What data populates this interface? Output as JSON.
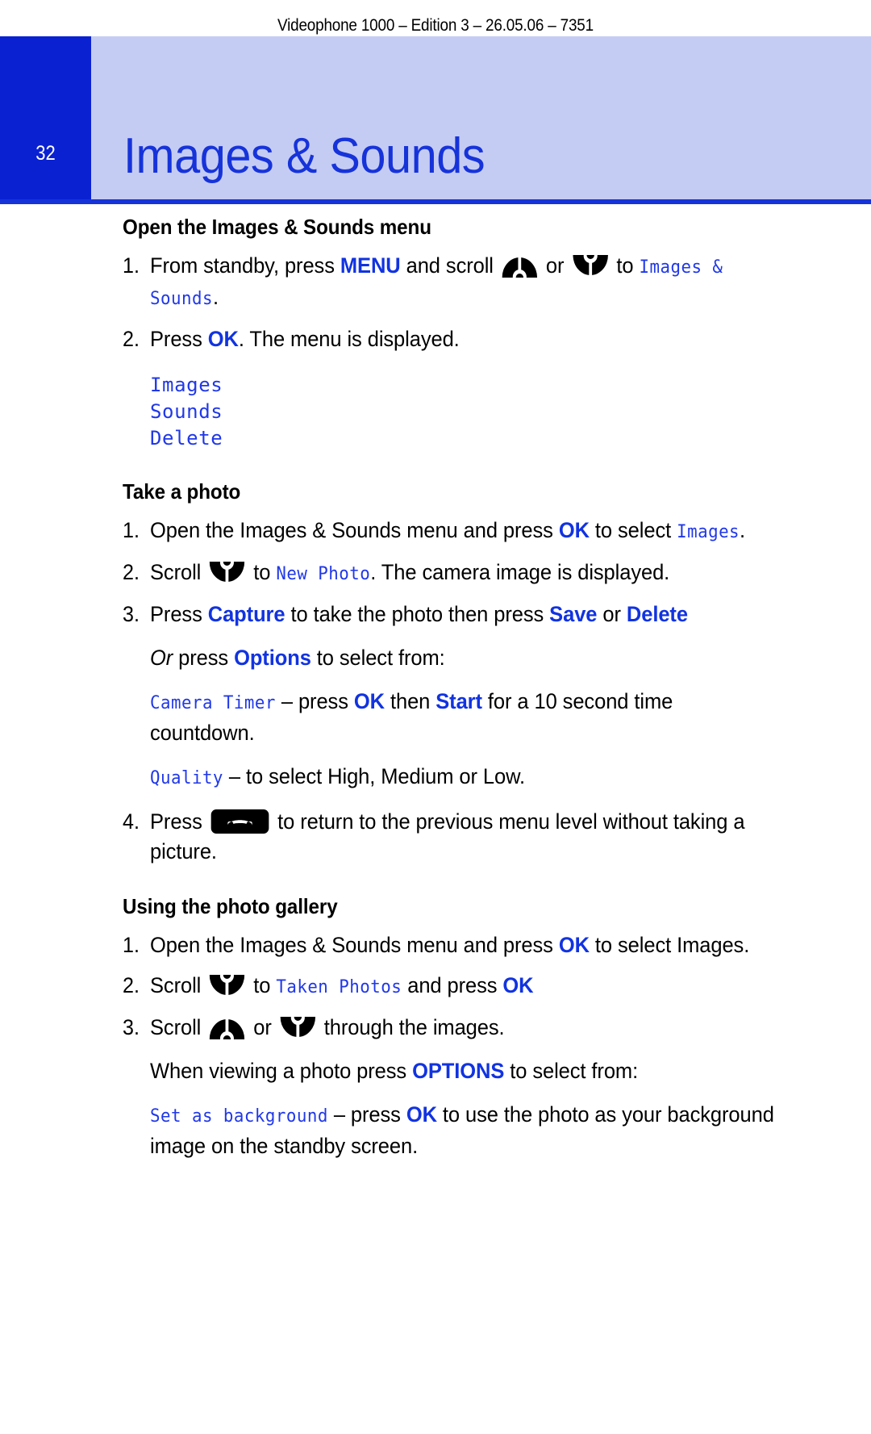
{
  "running_head": "Videophone 1000 – Edition 3 – 26.05.06 – 7351",
  "header": {
    "page_number": "32",
    "chapter_title": "Images & Sounds",
    "band_color": "#C5CCF3",
    "page_block_color": "#0A21D2",
    "title_color": "#1633DA",
    "rule_color": "#1533D8"
  },
  "colors": {
    "keyword_blue": "#1133E0",
    "lcd_blue": "#2038E8",
    "body_black": "#000000"
  },
  "icons": {
    "scroll_up": "scroll-up-icon",
    "scroll_down": "scroll-down-icon",
    "end_call": "end-call-icon"
  },
  "sections": [
    {
      "heading": "Open the Images & Sounds menu",
      "steps": [
        {
          "num": "1.",
          "parts": [
            {
              "t": "text",
              "v": "From standby, press "
            },
            {
              "t": "kw",
              "v": "MENU"
            },
            {
              "t": "text",
              "v": " and scroll "
            },
            {
              "t": "icon",
              "v": "scroll-up-icon"
            },
            {
              "t": "text",
              "v": " or "
            },
            {
              "t": "icon",
              "v": "scroll-down-icon"
            },
            {
              "t": "text",
              "v": " to "
            },
            {
              "t": "lcd",
              "v": "Images & Sounds"
            },
            {
              "t": "text",
              "v": "."
            }
          ]
        },
        {
          "num": "2.",
          "parts": [
            {
              "t": "text",
              "v": "Press "
            },
            {
              "t": "kw",
              "v": "OK"
            },
            {
              "t": "text",
              "v": ". The menu is displayed."
            }
          ]
        }
      ],
      "lcd_menu": [
        "Images",
        "Sounds",
        "Delete"
      ]
    },
    {
      "heading": "Take a photo",
      "steps": [
        {
          "num": "1.",
          "parts": [
            {
              "t": "text",
              "v": "Open the Images & Sounds menu and press "
            },
            {
              "t": "kw",
              "v": "OK"
            },
            {
              "t": "text",
              "v": " to select "
            },
            {
              "t": "lcd",
              "v": "Images"
            },
            {
              "t": "text",
              "v": "."
            }
          ]
        },
        {
          "num": "2.",
          "parts": [
            {
              "t": "text",
              "v": "Scroll "
            },
            {
              "t": "icon",
              "v": "scroll-down-icon"
            },
            {
              "t": "text",
              "v": " to "
            },
            {
              "t": "lcd",
              "v": "New Photo"
            },
            {
              "t": "text",
              "v": ". The camera image is displayed."
            }
          ]
        },
        {
          "num": "3.",
          "parts": [
            {
              "t": "text",
              "v": "Press "
            },
            {
              "t": "kw",
              "v": "Capture"
            },
            {
              "t": "text",
              "v": " to take the photo then press "
            },
            {
              "t": "kw",
              "v": "Save"
            },
            {
              "t": "text",
              "v": " or "
            },
            {
              "t": "kw",
              "v": "Delete"
            }
          ]
        }
      ],
      "paragraphs": [
        {
          "parts": [
            {
              "t": "it",
              "v": "Or"
            },
            {
              "t": "text",
              "v": " press "
            },
            {
              "t": "kw",
              "v": "Options"
            },
            {
              "t": "text",
              "v": " to select from:"
            }
          ]
        },
        {
          "parts": [
            {
              "t": "lcd",
              "v": "Camera Timer"
            },
            {
              "t": "text",
              "v": " – press "
            },
            {
              "t": "kw",
              "v": "OK"
            },
            {
              "t": "text",
              "v": " then "
            },
            {
              "t": "kw",
              "v": "Start"
            },
            {
              "t": "text",
              "v": " for a 10 second time countdown."
            }
          ]
        },
        {
          "parts": [
            {
              "t": "lcd",
              "v": "Quality"
            },
            {
              "t": "text",
              "v": " – to select High, Medium or Low."
            }
          ]
        }
      ],
      "steps_after": [
        {
          "num": "4.",
          "parts": [
            {
              "t": "text",
              "v": "Press "
            },
            {
              "t": "icon",
              "v": "end-call-icon"
            },
            {
              "t": "text",
              "v": " to return to the previous menu level without taking a picture."
            }
          ]
        }
      ]
    },
    {
      "heading": "Using the photo gallery",
      "steps": [
        {
          "num": "1.",
          "parts": [
            {
              "t": "text",
              "v": "Open the Images & Sounds menu and press "
            },
            {
              "t": "kw",
              "v": "OK"
            },
            {
              "t": "text",
              "v": " to select Images."
            }
          ]
        },
        {
          "num": "2.",
          "parts": [
            {
              "t": "text",
              "v": "Scroll "
            },
            {
              "t": "icon",
              "v": "scroll-down-icon"
            },
            {
              "t": "text",
              "v": " to "
            },
            {
              "t": "lcd",
              "v": "Taken Photos"
            },
            {
              "t": "text",
              "v": " and press "
            },
            {
              "t": "kw",
              "v": "OK"
            }
          ]
        },
        {
          "num": "3.",
          "parts": [
            {
              "t": "text",
              "v": "Scroll "
            },
            {
              "t": "icon",
              "v": "scroll-up-icon"
            },
            {
              "t": "text",
              "v": " or "
            },
            {
              "t": "icon",
              "v": "scroll-down-icon"
            },
            {
              "t": "text",
              "v": " through the images."
            }
          ]
        }
      ],
      "paragraphs": [
        {
          "parts": [
            {
              "t": "text",
              "v": "When viewing a photo press "
            },
            {
              "t": "kw",
              "v": "OPTIONS"
            },
            {
              "t": "text",
              "v": " to select from:"
            }
          ]
        },
        {
          "parts": [
            {
              "t": "lcd",
              "v": "Set as background"
            },
            {
              "t": "text",
              "v": " – press "
            },
            {
              "t": "kw",
              "v": "OK"
            },
            {
              "t": "text",
              "v": " to use the photo as your background image on the standby screen."
            }
          ]
        }
      ]
    }
  ]
}
